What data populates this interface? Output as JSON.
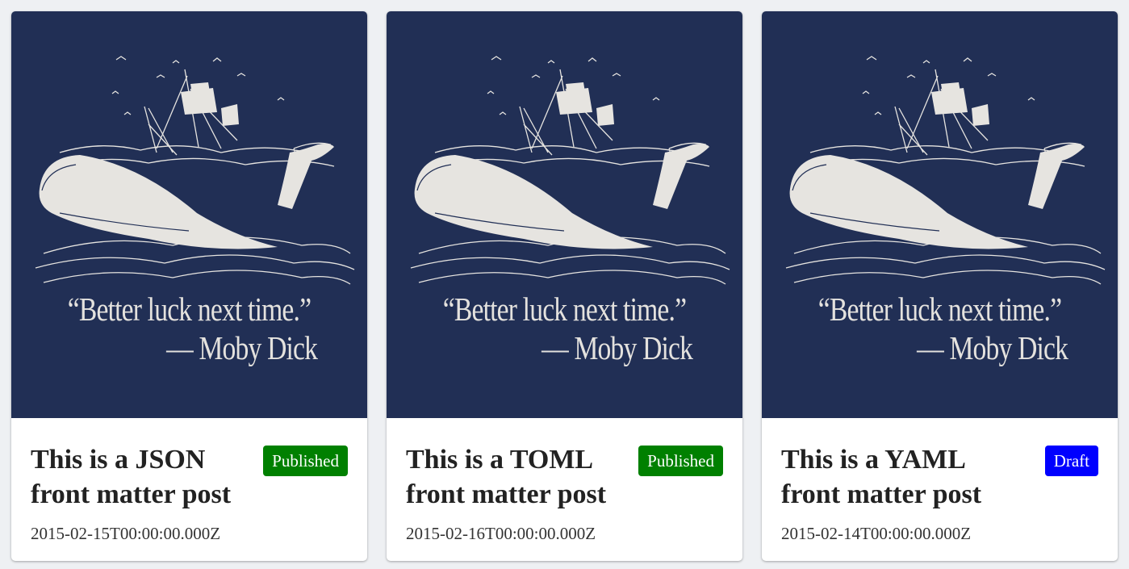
{
  "cover": {
    "quote": "“Better luck next time.”",
    "attribution": "— Moby Dick"
  },
  "colors": {
    "cover_background": "#212f55",
    "published_badge": "#008000",
    "draft_badge": "#0000ff"
  },
  "posts": [
    {
      "title": "This is a JSON front matter post",
      "status": "Published",
      "date": "2015-02-15T00:00:00.000Z"
    },
    {
      "title": "This is a TOML front matter post",
      "status": "Published",
      "date": "2015-02-16T00:00:00.000Z"
    },
    {
      "title": "This is a YAML front matter post",
      "status": "Draft",
      "date": "2015-02-14T00:00:00.000Z"
    }
  ]
}
